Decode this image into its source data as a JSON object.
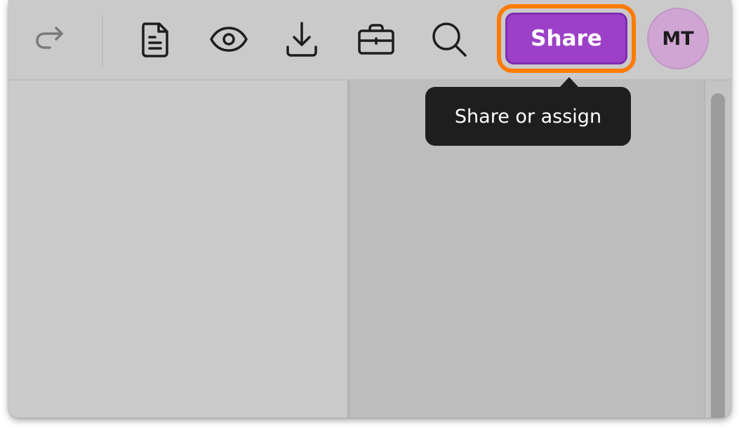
{
  "toolbar": {
    "icons": [
      {
        "name": "redo-icon"
      },
      {
        "name": "document-icon"
      },
      {
        "name": "eye-icon"
      },
      {
        "name": "download-icon"
      },
      {
        "name": "briefcase-icon"
      },
      {
        "name": "search-icon"
      }
    ],
    "share_label": "Share",
    "avatar_initials": "MT"
  },
  "tooltip": {
    "text": "Share or assign"
  },
  "colors": {
    "accent": "#9c40c8",
    "highlight_ring": "#ff7a00",
    "avatar_bg": "#cfa6d3",
    "tooltip_bg": "#1e1e1e"
  }
}
